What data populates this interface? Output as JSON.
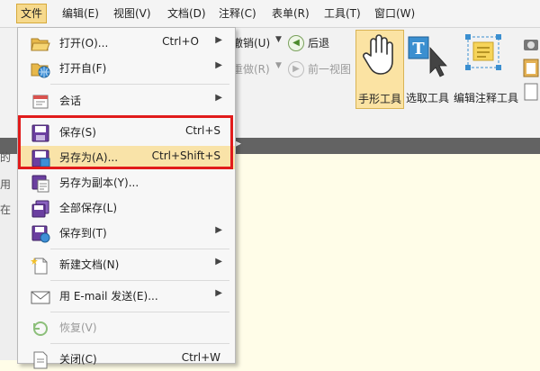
{
  "menubar": {
    "items": [
      {
        "label": "文件"
      },
      {
        "label": "编辑(E)"
      },
      {
        "label": "视图(V)"
      },
      {
        "label": "文档(D)"
      },
      {
        "label": "注释(C)"
      },
      {
        "label": "表单(R)"
      },
      {
        "label": "工具(T)"
      },
      {
        "label": "窗口(W)"
      }
    ]
  },
  "toolbar": {
    "undo": "撤销(U)",
    "back": "后退",
    "redo": "重做(R)",
    "forward": "前一视图",
    "hand_tool": "手形工具",
    "select_tool": "选取工具",
    "edit_annot_tool": "编辑注释工具"
  },
  "left_panel_fragments": [
    "的",
    "用",
    "在"
  ],
  "file_menu": {
    "items": [
      {
        "label": "打开(O)...",
        "shortcut": "Ctrl+O",
        "icon": "folder-open-icon",
        "submenu": true
      },
      {
        "label": "打开自(F)",
        "shortcut": "",
        "icon": "folder-globe-icon",
        "submenu": true
      },
      {
        "label": "会话",
        "shortcut": "",
        "icon": "session-icon",
        "submenu": true
      },
      {
        "label": "保存(S)",
        "shortcut": "Ctrl+S",
        "icon": "floppy-disk-icon",
        "submenu": false
      },
      {
        "label": "另存为(A)...",
        "shortcut": "Ctrl+Shift+S",
        "icon": "save-as-icon",
        "submenu": false
      },
      {
        "label": "另存为副本(Y)...",
        "shortcut": "",
        "icon": "save-copy-icon",
        "submenu": false
      },
      {
        "label": "全部保存(L)",
        "shortcut": "",
        "icon": "save-all-icon",
        "submenu": false
      },
      {
        "label": "保存到(T)",
        "shortcut": "",
        "icon": "save-to-icon",
        "submenu": true
      },
      {
        "label": "新建文档(N)",
        "shortcut": "",
        "icon": "new-document-icon",
        "submenu": true
      },
      {
        "label": "用 E-mail 发送(E)...",
        "shortcut": "",
        "icon": "email-icon",
        "submenu": true
      },
      {
        "label": "恢复(V)",
        "shortcut": "",
        "icon": "revert-icon",
        "submenu": false
      },
      {
        "label": "关闭(C)",
        "shortcut": "Ctrl+W",
        "icon": "close-document-icon",
        "submenu": false
      }
    ]
  },
  "colors": {
    "highlight_box": "#e11b1b",
    "selected_row": "#f9e3a8",
    "active_menu": "#f6d98c",
    "document_bg": "#fffde8"
  }
}
